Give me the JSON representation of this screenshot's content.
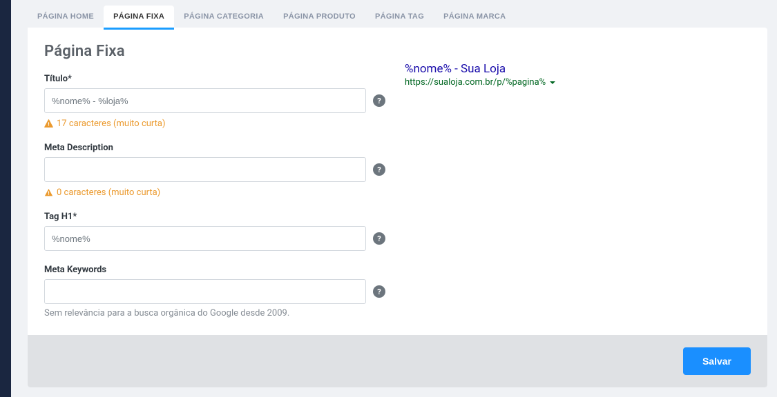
{
  "tabs": [
    {
      "label": "PÁGINA HOME",
      "active": false
    },
    {
      "label": "PÁGINA FIXA",
      "active": true
    },
    {
      "label": "PÁGINA CATEGORIA",
      "active": false
    },
    {
      "label": "PÁGINA PRODUTO",
      "active": false
    },
    {
      "label": "PÁGINA TAG",
      "active": false
    },
    {
      "label": "PÁGINA MARCA",
      "active": false
    }
  ],
  "page_title": "Página Fixa",
  "form": {
    "titulo": {
      "label": "Título*",
      "value": "%nome% - %loja%",
      "validation": "17 caracteres (muito curta)"
    },
    "meta_description": {
      "label": "Meta Description",
      "value": "",
      "validation": "0 caracteres (muito curta)"
    },
    "tag_h1": {
      "label": "Tag H1*",
      "value": "%nome%"
    },
    "meta_keywords": {
      "label": "Meta Keywords",
      "value": "",
      "help": "Sem relevância para a busca orgânica do Google desde 2009."
    }
  },
  "preview": {
    "title": "%nome% - Sua Loja",
    "url": "https://sualoja.com.br/p/%pagina%"
  },
  "footer": {
    "save_label": "Salvar"
  },
  "help_symbol": "?"
}
